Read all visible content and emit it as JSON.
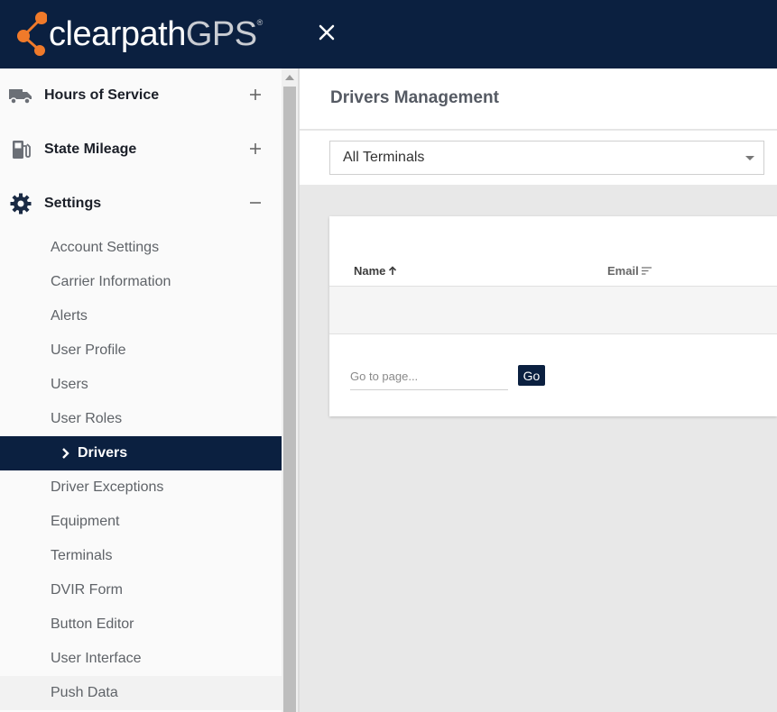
{
  "header": {
    "logo_main": "clearpath",
    "logo_accent": "GPS",
    "logo_mark": "®",
    "close_icon": "close-icon"
  },
  "sidebar": {
    "sections": [
      {
        "label": "Hours of Service",
        "icon": "truck-icon",
        "toggle": "+"
      },
      {
        "label": "State Mileage",
        "icon": "fuel-pump-icon",
        "toggle": "+"
      },
      {
        "label": "Settings",
        "icon": "gear-icon",
        "toggle": "−"
      }
    ],
    "settings_items": [
      {
        "label": "Account Settings"
      },
      {
        "label": "Carrier Information"
      },
      {
        "label": "Alerts"
      },
      {
        "label": "User Profile"
      },
      {
        "label": "Users"
      },
      {
        "label": "User Roles"
      },
      {
        "label": "Drivers",
        "active": true
      },
      {
        "label": "Driver Exceptions"
      },
      {
        "label": "Equipment"
      },
      {
        "label": "Terminals"
      },
      {
        "label": "DVIR Form"
      },
      {
        "label": "Button Editor"
      },
      {
        "label": "User Interface"
      },
      {
        "label": "Push Data"
      }
    ]
  },
  "main": {
    "title": "Drivers Management",
    "terminal_select": {
      "value": "All Terminals"
    },
    "table": {
      "columns": [
        {
          "label": "Name",
          "sort": "ascending"
        },
        {
          "label": "Email",
          "sort": "none"
        }
      ],
      "rows": []
    },
    "pagination": {
      "goto_placeholder": "Go to page...",
      "go_label": "Go"
    }
  },
  "colors": {
    "navy": "#0b2040",
    "accent_orange": "#f07a2a"
  }
}
